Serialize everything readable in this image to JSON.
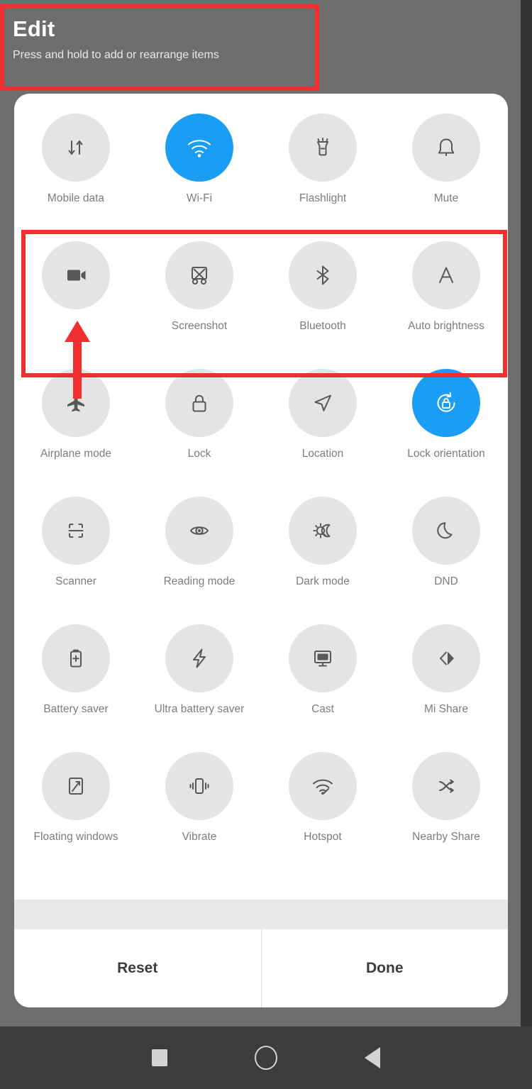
{
  "header": {
    "title": "Edit",
    "subtitle": "Press and hold to add or rearrange items"
  },
  "colors": {
    "active_tile": "#1a9ef5",
    "tile_background": "#e4e4e4",
    "annotation_red": "#f03030",
    "panel_background": "#ffffff",
    "screen_background": "#6e6e6e",
    "navbar_background": "#3c3c3c"
  },
  "annotations": [
    {
      "name": "edit-header-highlight",
      "shape": "rectangle",
      "color": "#f03030"
    },
    {
      "name": "second-row-highlight",
      "shape": "rectangle",
      "color": "#f03030"
    },
    {
      "name": "screen-recorder-pointer",
      "shape": "arrow",
      "color": "#f03030",
      "direction": "up"
    }
  ],
  "panel": {
    "rows": [
      {
        "tiles": [
          {
            "label": "Mobile data",
            "icon": "mobile-data-icon",
            "active": false
          },
          {
            "label": "Wi-Fi",
            "icon": "wifi-icon",
            "active": true
          },
          {
            "label": "Flashlight",
            "icon": "flashlight-icon",
            "active": false
          },
          {
            "label": "Mute",
            "icon": "bell-icon",
            "active": false
          }
        ]
      },
      {
        "tiles": [
          {
            "label": "",
            "icon": "screen-recorder-icon",
            "active": false
          },
          {
            "label": "Screenshot",
            "icon": "screenshot-icon",
            "active": false
          },
          {
            "label": "Bluetooth",
            "icon": "bluetooth-icon",
            "active": false
          },
          {
            "label": "Auto brightness",
            "icon": "auto-brightness-icon",
            "active": false
          }
        ]
      },
      {
        "tiles": [
          {
            "label": "Airplane mode",
            "icon": "airplane-icon",
            "active": false
          },
          {
            "label": "Lock",
            "icon": "lock-icon",
            "active": false
          },
          {
            "label": "Location",
            "icon": "location-icon",
            "active": false
          },
          {
            "label": "Lock orientation",
            "icon": "lock-orientation-icon",
            "active": true
          }
        ]
      },
      {
        "tiles": [
          {
            "label": "Scanner",
            "icon": "scanner-icon",
            "active": false
          },
          {
            "label": "Reading mode",
            "icon": "eye-icon",
            "active": false
          },
          {
            "label": "Dark mode",
            "icon": "dark-mode-icon",
            "active": false
          },
          {
            "label": "DND",
            "icon": "moon-icon",
            "active": false
          }
        ]
      },
      {
        "tiles": [
          {
            "label": "Battery saver",
            "icon": "battery-saver-icon",
            "active": false
          },
          {
            "label": "Ultra battery saver",
            "icon": "bolt-icon",
            "active": false
          },
          {
            "label": "Cast",
            "icon": "cast-icon",
            "active": false
          },
          {
            "label": "Mi Share",
            "icon": "mi-share-icon",
            "active": false
          }
        ]
      },
      {
        "tiles": [
          {
            "label": "Floating windows",
            "icon": "floating-windows-icon",
            "active": false
          },
          {
            "label": "Vibrate",
            "icon": "vibrate-icon",
            "active": false
          },
          {
            "label": "Hotspot",
            "icon": "hotspot-icon",
            "active": false
          },
          {
            "label": "Nearby Share",
            "icon": "nearby-share-icon",
            "active": false
          }
        ]
      }
    ],
    "actions": {
      "reset_label": "Reset",
      "done_label": "Done"
    }
  },
  "navbar": {
    "recents": "recents-square-icon",
    "home": "home-circle-icon",
    "back": "back-triangle-icon"
  }
}
